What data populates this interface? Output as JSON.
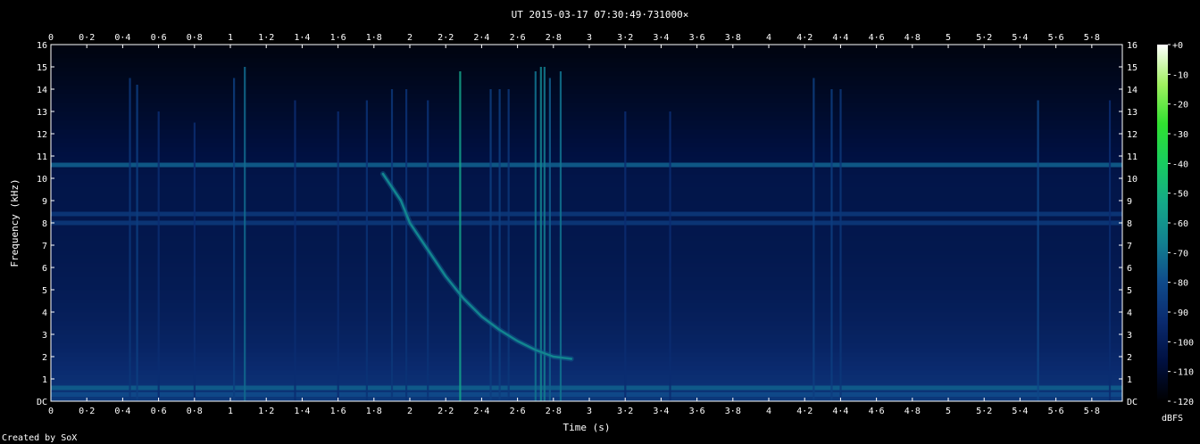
{
  "chart_data": {
    "type": "heatmap",
    "title": "UT 2015-03-17 07:30:49·731000×",
    "xlabel": "Time (s)",
    "ylabel": "Frequency (kHz)",
    "colorbar_label": "dBFS",
    "footer": "Created by SoX",
    "xlim": [
      0,
      5.97
    ],
    "ylim": [
      0,
      16
    ],
    "zlim": [
      -120,
      0
    ],
    "x_ticks": [
      "0",
      "0·2",
      "0·4",
      "0·6",
      "0·8",
      "1",
      "1·2",
      "1·4",
      "1·6",
      "1·8",
      "2",
      "2·2",
      "2·4",
      "2·6",
      "2·8",
      "3",
      "3·2",
      "3·4",
      "3·6",
      "3·8",
      "4",
      "4·2",
      "4·4",
      "4·6",
      "4·8",
      "5",
      "5·2",
      "5·4",
      "5·6",
      "5·8"
    ],
    "y_ticks": [
      "DC",
      "1",
      "2",
      "3",
      "4",
      "5",
      "6",
      "7",
      "8",
      "9",
      "10",
      "11",
      "12",
      "13",
      "14",
      "15",
      "16"
    ],
    "z_ticks": [
      "+0",
      "-10",
      "-20",
      "-30",
      "-40",
      "-50",
      "-60",
      "-70",
      "-80",
      "-90",
      "-100",
      "-110",
      "-120"
    ],
    "colormap": [
      "#000000",
      "#001040",
      "#0a2a6e",
      "#0f4a8a",
      "#128090",
      "#14a888",
      "#18cc60",
      "#30e030",
      "#a0f060",
      "#ffffff"
    ],
    "background_level_db": -105,
    "horizontal_lines": [
      {
        "freq_khz": 10.6,
        "level_db": -75
      },
      {
        "freq_khz": 8.4,
        "level_db": -88
      },
      {
        "freq_khz": 8.0,
        "level_db": -88
      },
      {
        "freq_khz": 0.6,
        "level_db": -75
      },
      {
        "freq_khz": 0.3,
        "level_db": -80
      }
    ],
    "impulses": [
      {
        "time_s": 0.44,
        "f_max_khz": 14.5,
        "level_db": -88
      },
      {
        "time_s": 0.48,
        "f_max_khz": 14.2,
        "level_db": -85
      },
      {
        "time_s": 0.6,
        "f_max_khz": 13.0,
        "level_db": -92
      },
      {
        "time_s": 0.8,
        "f_max_khz": 12.5,
        "level_db": -92
      },
      {
        "time_s": 1.02,
        "f_max_khz": 14.5,
        "level_db": -85
      },
      {
        "time_s": 1.08,
        "f_max_khz": 15.0,
        "level_db": -72
      },
      {
        "time_s": 1.36,
        "f_max_khz": 13.5,
        "level_db": -92
      },
      {
        "time_s": 1.6,
        "f_max_khz": 13.0,
        "level_db": -92
      },
      {
        "time_s": 1.76,
        "f_max_khz": 13.5,
        "level_db": -90
      },
      {
        "time_s": 1.9,
        "f_max_khz": 14.0,
        "level_db": -88
      },
      {
        "time_s": 1.98,
        "f_max_khz": 14.0,
        "level_db": -90
      },
      {
        "time_s": 2.1,
        "f_max_khz": 13.5,
        "level_db": -90
      },
      {
        "time_s": 2.28,
        "f_max_khz": 14.8,
        "level_db": -55
      },
      {
        "time_s": 2.45,
        "f_max_khz": 14.0,
        "level_db": -85
      },
      {
        "time_s": 2.5,
        "f_max_khz": 14.0,
        "level_db": -85
      },
      {
        "time_s": 2.55,
        "f_max_khz": 14.0,
        "level_db": -88
      },
      {
        "time_s": 2.7,
        "f_max_khz": 14.8,
        "level_db": -70
      },
      {
        "time_s": 2.73,
        "f_max_khz": 15.0,
        "level_db": -65
      },
      {
        "time_s": 2.75,
        "f_max_khz": 15.0,
        "level_db": -68
      },
      {
        "time_s": 2.78,
        "f_max_khz": 14.5,
        "level_db": -75
      },
      {
        "time_s": 2.84,
        "f_max_khz": 14.8,
        "level_db": -70
      },
      {
        "time_s": 3.2,
        "f_max_khz": 13.0,
        "level_db": -92
      },
      {
        "time_s": 3.45,
        "f_max_khz": 13.0,
        "level_db": -92
      },
      {
        "time_s": 4.25,
        "f_max_khz": 14.5,
        "level_db": -85
      },
      {
        "time_s": 4.35,
        "f_max_khz": 14.0,
        "level_db": -85
      },
      {
        "time_s": 4.4,
        "f_max_khz": 14.0,
        "level_db": -88
      },
      {
        "time_s": 5.5,
        "f_max_khz": 13.5,
        "level_db": -82
      },
      {
        "time_s": 5.9,
        "f_max_khz": 13.5,
        "level_db": -92
      }
    ],
    "chirp": {
      "points": [
        {
          "time_s": 1.85,
          "freq_khz": 10.2
        },
        {
          "time_s": 1.95,
          "freq_khz": 9.0
        },
        {
          "time_s": 2.0,
          "freq_khz": 8.0
        },
        {
          "time_s": 2.1,
          "freq_khz": 6.8
        },
        {
          "time_s": 2.2,
          "freq_khz": 5.6
        },
        {
          "time_s": 2.3,
          "freq_khz": 4.6
        },
        {
          "time_s": 2.4,
          "freq_khz": 3.8
        },
        {
          "time_s": 2.5,
          "freq_khz": 3.2
        },
        {
          "time_s": 2.6,
          "freq_khz": 2.7
        },
        {
          "time_s": 2.7,
          "freq_khz": 2.3
        },
        {
          "time_s": 2.8,
          "freq_khz": 2.0
        },
        {
          "time_s": 2.9,
          "freq_khz": 1.9
        }
      ],
      "level_db": -75
    }
  }
}
